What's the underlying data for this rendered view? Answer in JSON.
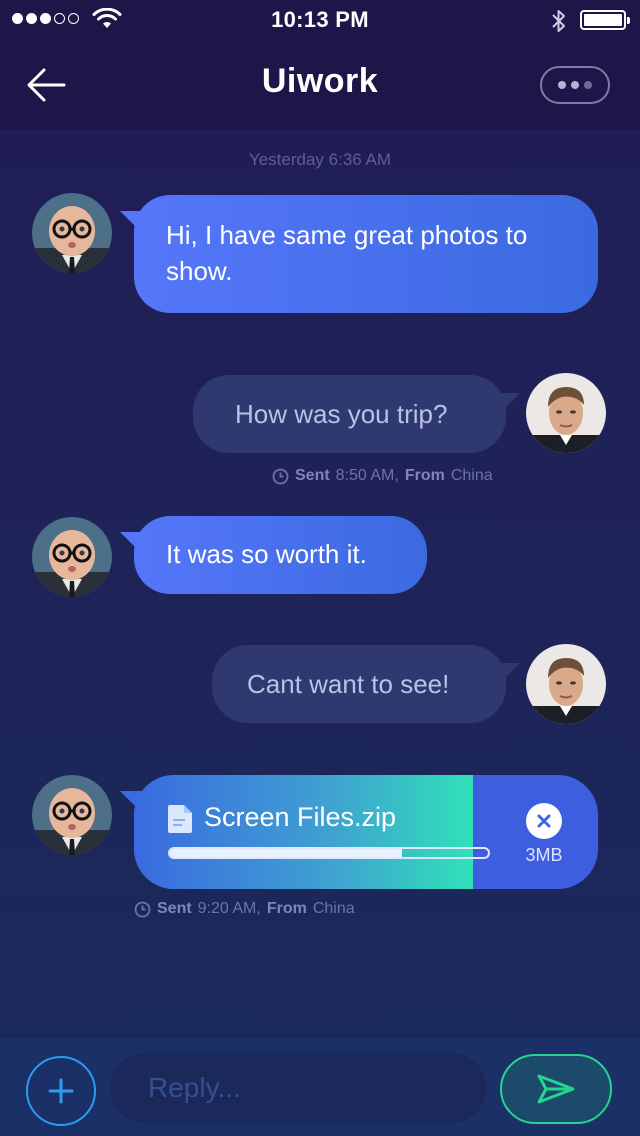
{
  "status_bar": {
    "time": "10:13 PM",
    "signal_bars_filled": 3,
    "signal_bars_total": 5,
    "wifi_icon": "wifi-icon",
    "bluetooth_icon": "bluetooth-icon",
    "battery_level": 1.0
  },
  "header": {
    "title": "Uiwork",
    "back_icon": "arrow-left-icon",
    "more_icon": "ellipsis-icon"
  },
  "conversation": {
    "timestamp": "Yesterday 6:36 AM",
    "messages": [
      {
        "direction": "incoming",
        "text": "Hi, I have same great photos to show."
      },
      {
        "direction": "outgoing",
        "text": "How was you trip?",
        "meta": {
          "sent_label": "Sent",
          "time": "8:50 AM,",
          "from_label": "From",
          "location": "China"
        }
      },
      {
        "direction": "incoming",
        "text": "It was so worth it."
      },
      {
        "direction": "outgoing",
        "text": "Cant want to see!"
      }
    ],
    "file_message": {
      "file_name": "Screen Files.zip",
      "size": "3MB",
      "progress": 0.73,
      "file_icon": "document-icon",
      "cancel_icon": "close-icon",
      "meta": {
        "sent_label": "Sent",
        "time": "9:20 AM,",
        "from_label": "From",
        "location": "China"
      }
    }
  },
  "composer": {
    "placeholder": "Reply...",
    "add_icon": "plus-icon",
    "send_icon": "send-icon"
  },
  "colors": {
    "incoming_bubble": "#5676fa",
    "outgoing_bubble": "#2f3970",
    "accent_blue": "#2a9df2",
    "accent_green": "#25d48f"
  }
}
